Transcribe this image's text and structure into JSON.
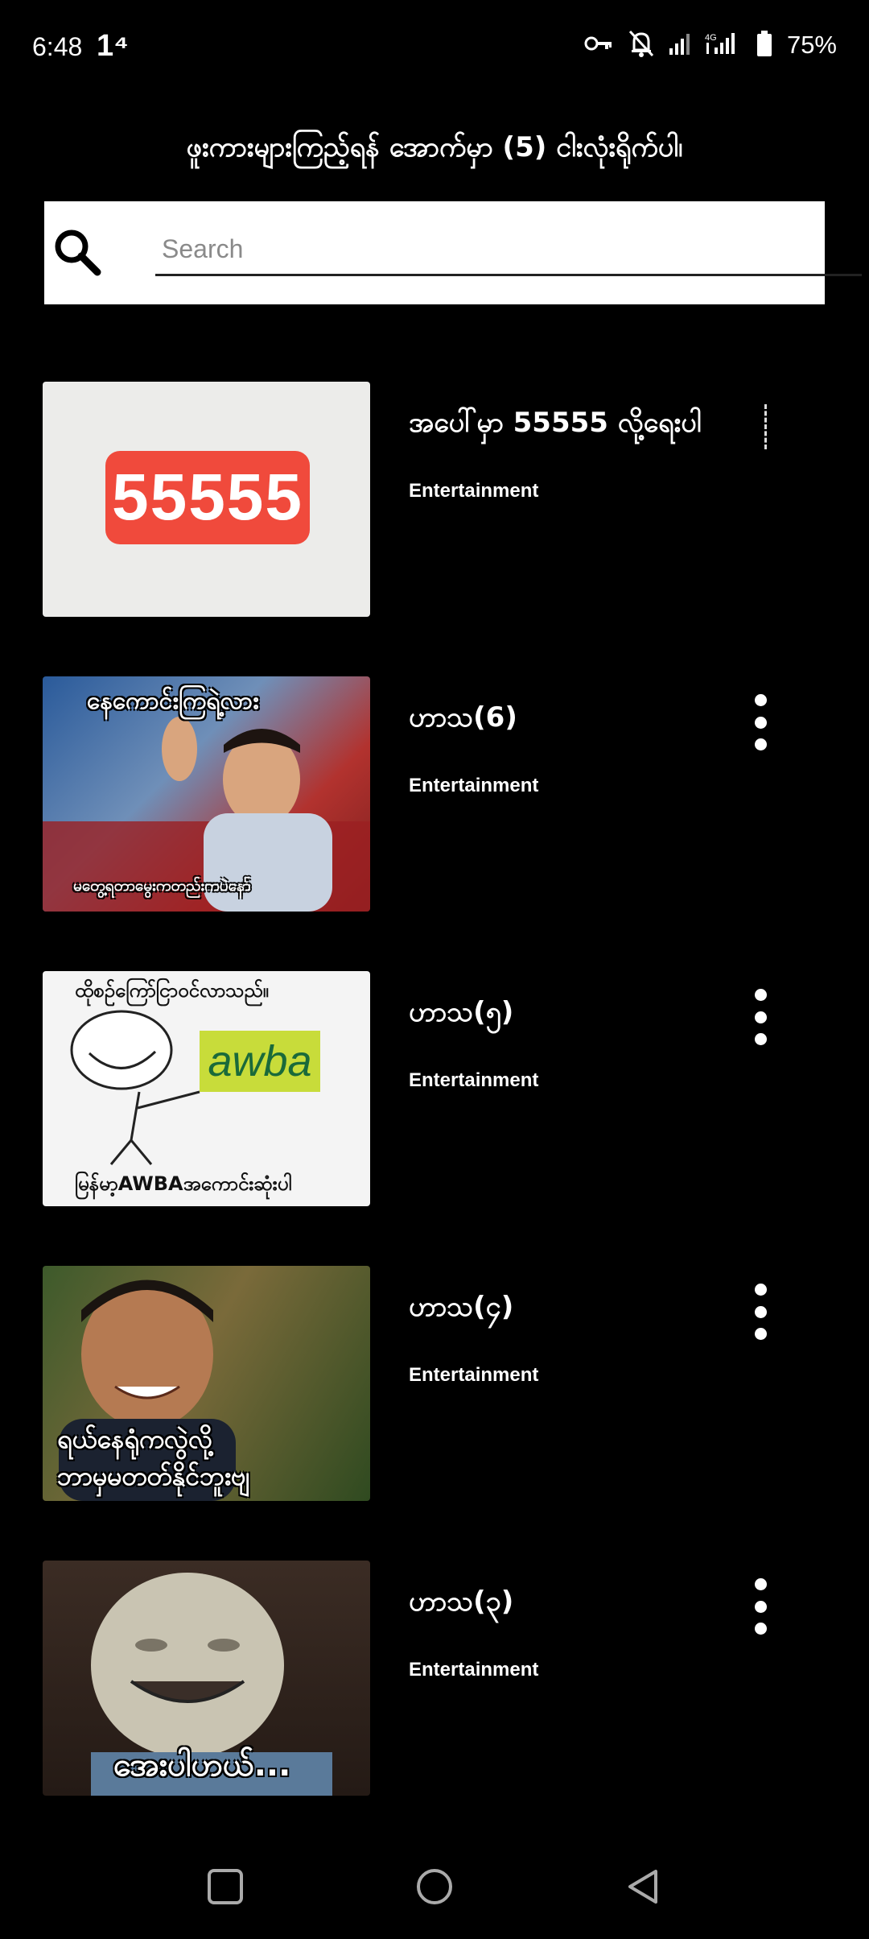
{
  "status_bar": {
    "time": "6:48",
    "data_indicator": "1⁴",
    "battery": "75%",
    "icons": [
      "vpn-key-icon",
      "notifications-off-icon",
      "signal-icon",
      "4g-signal-icon",
      "battery-icon"
    ]
  },
  "header": {
    "instruction": "ဖူးကားများကြည့်ရန် အောက်မှာ (5) ငါးလုံးရိုက်ပါ၊"
  },
  "search": {
    "placeholder": "Search",
    "value": ""
  },
  "items": [
    {
      "title": "အပေါ်မှာ 55555 လို့ရေးပါ",
      "category": "Entertainment",
      "thumb_text": [
        "55555"
      ]
    },
    {
      "title": "ဟာသ(6)",
      "category": "Entertainment",
      "thumb_text": [
        "နေကောင်းကြရဲ့လား",
        "မတွေ့ရတာမွေးကတည်းကပဲနော်"
      ]
    },
    {
      "title": "ဟာသ(၅)",
      "category": "Entertainment",
      "thumb_text": [
        "ထိုစဉ်ကြော်ငြာဝင်လာသည်။",
        "awba",
        "မြန်မာ့AWBAအကောင်းဆုံးပါ"
      ]
    },
    {
      "title": "ဟာသ(၄)",
      "category": "Entertainment",
      "thumb_text": [
        "ရယ်နေရုံကလွဲလို့",
        "ဘာမှမတတ်နိုင်ဘူးဗျ"
      ]
    },
    {
      "title": "ဟာသ(၃)",
      "category": "Entertainment",
      "thumb_text": [
        "အေးပါဟယ်..."
      ]
    }
  ],
  "nav": {
    "icons": [
      "recents-square-icon",
      "home-circle-icon",
      "back-triangle-icon"
    ]
  }
}
